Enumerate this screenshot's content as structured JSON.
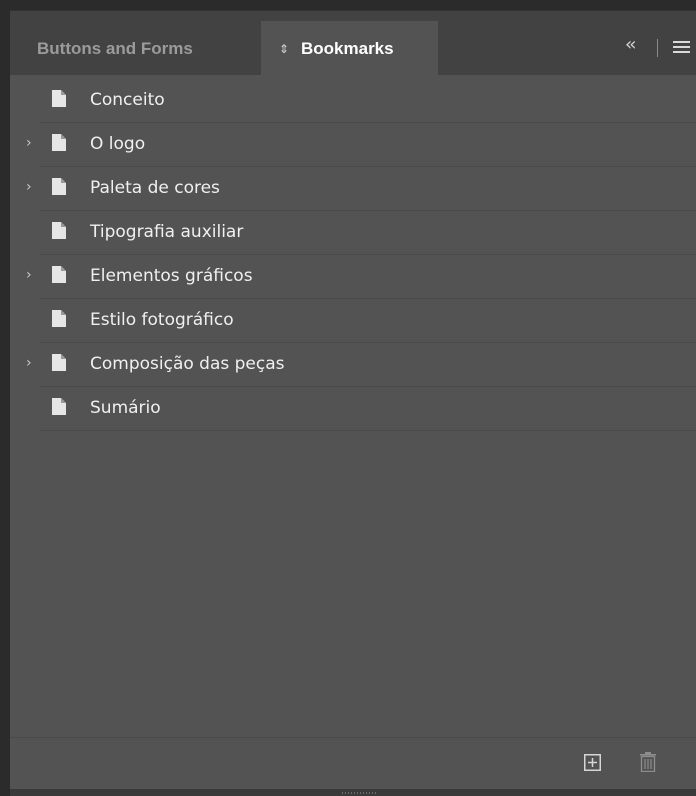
{
  "tabs": {
    "inactive_label": "Buttons and Forms",
    "active_label": "Bookmarks"
  },
  "bookmarks": [
    {
      "label": "Conceito",
      "expandable": false
    },
    {
      "label": "O logo",
      "expandable": true
    },
    {
      "label": "Paleta de cores",
      "expandable": true
    },
    {
      "label": "Tipografia auxiliar",
      "expandable": false
    },
    {
      "label": "Elementos gráficos",
      "expandable": true
    },
    {
      "label": "Estilo fotográfico",
      "expandable": false
    },
    {
      "label": "Composição das peças",
      "expandable": true
    },
    {
      "label": "Sumário",
      "expandable": false
    }
  ],
  "icons": {
    "collapse": "double-chevron-left-icon",
    "menu": "hamburger-menu-icon",
    "bookmark": "page-icon",
    "new_bookmark": "new-bookmark-icon",
    "delete": "trash-icon"
  },
  "colors": {
    "panel_bg": "#535353",
    "tabbar_bg": "#424242",
    "text": "#f0f0f0"
  }
}
